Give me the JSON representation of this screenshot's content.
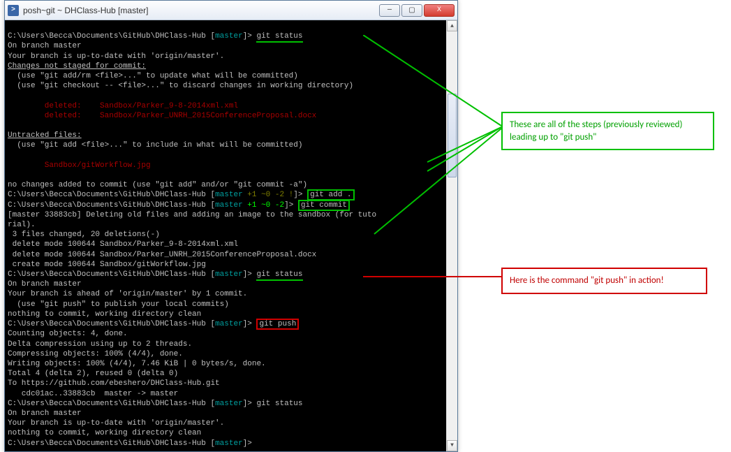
{
  "titlebar": {
    "icon_label": ">",
    "title": "posh~git ~ DHClass-Hub [master]",
    "min": "—",
    "max": "▢",
    "close": "X"
  },
  "callout1": {
    "line1": "These are all of the steps (previously reviewed)",
    "line2": "leading up to \"git push\""
  },
  "callout2": {
    "text": "Here is the command \"git push\" in action!"
  },
  "scrollbar": {
    "up": "▲",
    "down": "▼"
  },
  "term": {
    "p": "C:\\Users\\Becca\\Documents\\GitHub\\DHClass-Hub [",
    "master": "master",
    "close": "]",
    "gt": "> ",
    "status1_cmd": "git status",
    "on_branch": "On branch master",
    "uptodate": "Your branch is up-to-date with 'origin/master'.",
    "cns_head": "Changes not staged for commit:",
    "cns_hint1": "  (use \"git add/rm <file>...\" to update what will be committed)",
    "cns_hint2": "  (use \"git checkout -- <file>...\" to discard changes in working directory)",
    "del1": "        deleted:    Sandbox/Parker_9-8-2014xml.xml",
    "del2": "        deleted:    Sandbox/Parker_UNRH_2015ConferenceProposal.docx",
    "untracked_head": "Untracked files:",
    "untracked_hint": "  (use \"git add <file>...\" to include in what will be committed)",
    "untracked1": "        Sandbox/gitWorkflow.jpg",
    "nochanges": "no changes added to commit (use \"git add\" and/or \"git commit -a\")",
    "branch_tag_add": " +1 ~0 -2 !",
    "add_cmd": "git add .",
    "branch_tag_commit": " +1 ~0 -2",
    "commit_cmd": "git commit",
    "commit_out1": "[master 33883cb] Deleting old files and adding an image to the sandbox (for tuto",
    "commit_out1b": "rial).",
    "commit_out2": " 3 files changed, 20 deletions(-)",
    "commit_out3": " delete mode 100644 Sandbox/Parker_9-8-2014xml.xml",
    "commit_out4": " delete mode 100644 Sandbox/Parker_UNRH_2015ConferenceProposal.docx",
    "commit_out5": " create mode 100644 Sandbox/gitWorkflow.jpg",
    "status2_cmd": "git status",
    "ahead": "Your branch is ahead of 'origin/master' by 1 commit.",
    "push_hint": "  (use \"git push\" to publish your local commits)",
    "clean": "nothing to commit, working directory clean",
    "push_cmd": "git push",
    "push1": "Counting objects: 4, done.",
    "push2": "Delta compression using up to 2 threads.",
    "push3": "Compressing objects: 100% (4/4), done.",
    "push4": "Writing objects: 100% (4/4), 7.46 KiB | 0 bytes/s, done.",
    "push5": "Total 4 (delta 2), reused 0 (delta 0)",
    "push6": "To https://github.com/ebeshero/DHClass-Hub.git",
    "push7": "   cdc01ac..33883cb  master -> master",
    "status3_cmd": "git status"
  }
}
